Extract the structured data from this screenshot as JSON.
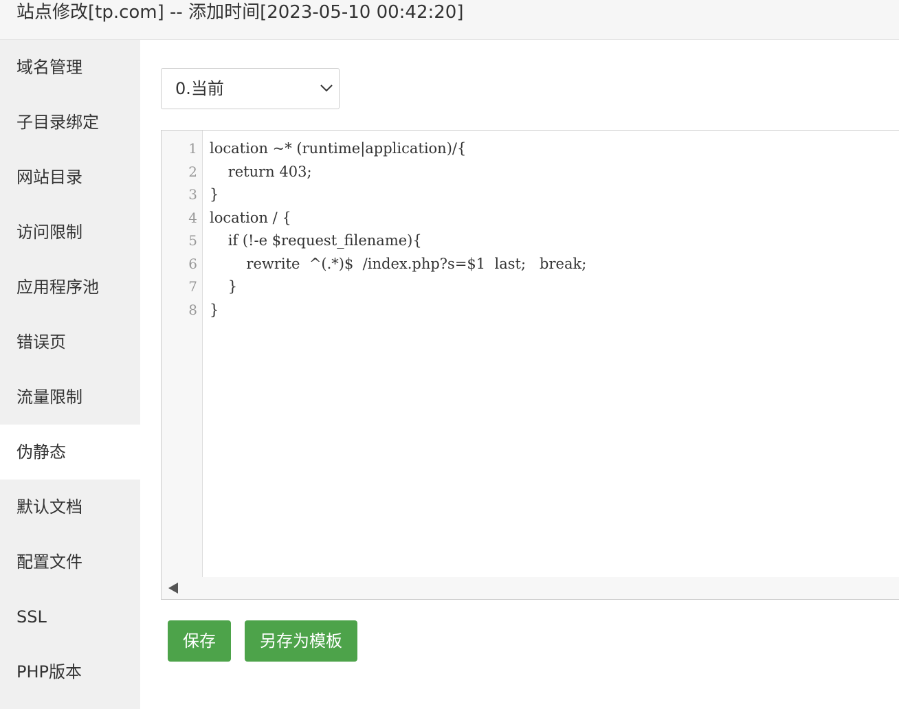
{
  "header": {
    "title": "站点修改[tp.com] -- 添加时间[2023-05-10 00:42:20]"
  },
  "sidebar": {
    "items": [
      {
        "label": "域名管理"
      },
      {
        "label": "子目录绑定"
      },
      {
        "label": "网站目录"
      },
      {
        "label": "访问限制"
      },
      {
        "label": "应用程序池"
      },
      {
        "label": "错误页"
      },
      {
        "label": "流量限制"
      },
      {
        "label": "伪静态",
        "active": true
      },
      {
        "label": "默认文档"
      },
      {
        "label": "配置文件"
      },
      {
        "label": "SSL"
      },
      {
        "label": "PHP版本"
      }
    ]
  },
  "rewrite": {
    "select_value": "0.当前",
    "editor": {
      "line_numbers": [
        "1",
        "2",
        "3",
        "4",
        "5",
        "6",
        "7",
        "8"
      ],
      "lines": [
        "location ~* (runtime|application)/{",
        "    return 403;",
        "}",
        "location / {",
        "    if (!-e $request_filename){",
        "        rewrite  ^(.*)$  /index.php?s=$1  last;   break;",
        "    }",
        "}"
      ]
    },
    "buttons": {
      "save": "保存",
      "save_template": "另存为模板"
    }
  },
  "colors": {
    "accent": "#4da34a",
    "sidebar_bg": "#f0f0f0",
    "active_bg": "#ffffff"
  }
}
